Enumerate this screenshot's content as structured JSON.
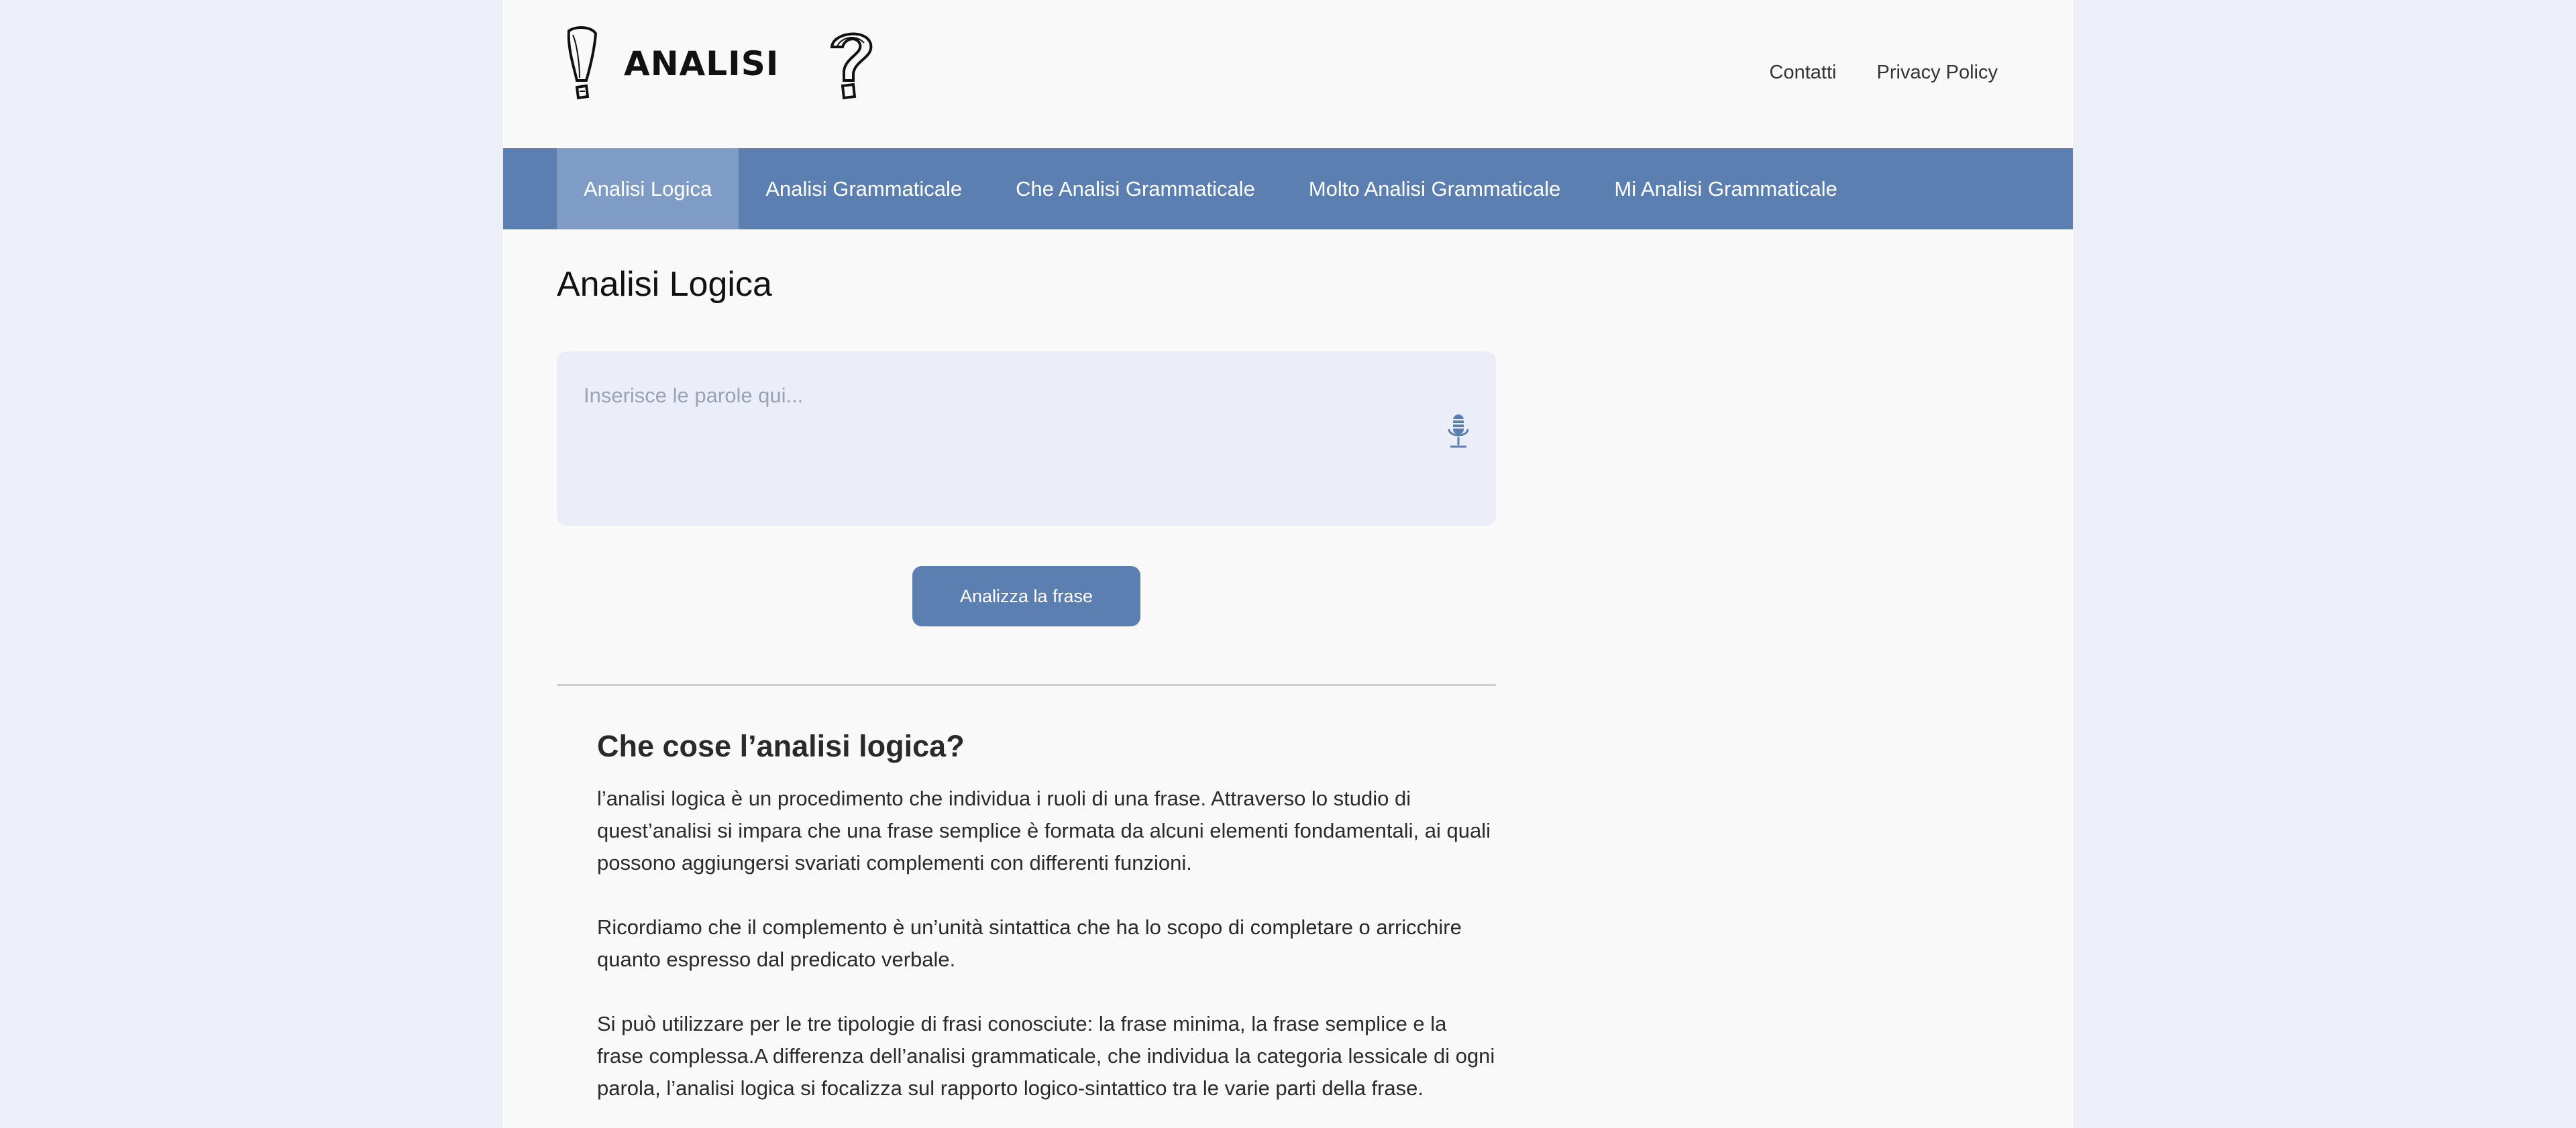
{
  "header": {
    "logo_text": "ANALISI",
    "links": [
      "Contatti",
      "Privacy Policy"
    ]
  },
  "nav": {
    "items": [
      {
        "label": "Analisi Logica",
        "active": true
      },
      {
        "label": "Analisi Grammaticale",
        "active": false
      },
      {
        "label": "Che Analisi Grammaticale",
        "active": false
      },
      {
        "label": "Molto Analisi Grammaticale",
        "active": false
      },
      {
        "label": "Mi Analisi Grammaticale",
        "active": false
      }
    ]
  },
  "main": {
    "title": "Analisi Logica",
    "input": {
      "placeholder": "Inserisce le parole qui...",
      "value": "",
      "mic_icon": "microphone-icon"
    },
    "analyze_button": "Analizza la frase"
  },
  "article": {
    "heading": "Che cose l’analisi logica?",
    "paragraphs": [
      " l’analisi logica è un procedimento che individua i ruoli di una frase. Attraverso lo studio di quest’analisi si impara che una frase semplice è formata da alcuni elementi fondamentali, ai quali possono aggiungersi svariati complementi con differenti funzioni.",
      "Ricordiamo che il complemento è un’unità sintattica che ha lo scopo di completare o arricchire quanto espresso dal predicato verbale.",
      "Si può utilizzare per le tre tipologie di frasi conosciute: la frase minima, la frase semplice e la frase complessa.A differenza dell’analisi grammaticale, che individua la categoria lessicale di ogni parola, l’analisi logica si focalizza sul rapporto logico-sintattico tra le varie parti della frase."
    ]
  },
  "colors": {
    "nav_background": "#5c7fb1",
    "nav_active": "#7f9cc6",
    "page_background": "#eceff7",
    "content_background": "#f9f9f9",
    "input_background": "#ebeef8",
    "button": "#5c7fb1"
  }
}
